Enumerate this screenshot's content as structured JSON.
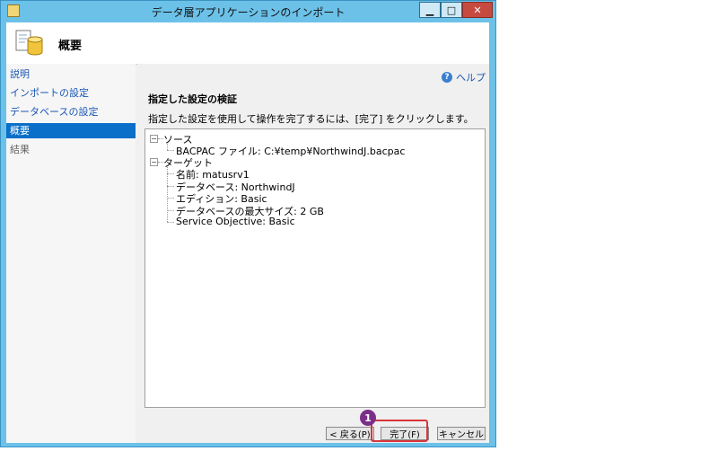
{
  "window": {
    "title": "データ層アプリケーションのインポート",
    "header_title": "概要"
  },
  "sidebar": {
    "items": [
      {
        "label": "説明",
        "state": "normal"
      },
      {
        "label": "インポートの設定",
        "state": "normal"
      },
      {
        "label": "データベースの設定",
        "state": "normal"
      },
      {
        "label": "概要",
        "state": "selected"
      },
      {
        "label": "結果",
        "state": "disabled"
      }
    ]
  },
  "main": {
    "help_label": "ヘルプ",
    "section_title": "指定した設定の検証",
    "description": "指定した設定を使用して操作を完了するには、[完了] をクリックします。",
    "tree": {
      "source": {
        "label": "ソース",
        "children": [
          "BACPAC ファイル: C:¥temp¥NorthwindJ.bacpac"
        ]
      },
      "target": {
        "label": "ターゲット",
        "children": [
          "名前: matusrv1",
          "データベース: NorthwindJ",
          "エディション: Basic",
          "データベースの最大サイズ: 2 GB",
          "Service Objective: Basic"
        ]
      }
    }
  },
  "buttons": {
    "back": "< 戻る(P)",
    "finish": "完了(F)",
    "cancel": "キャンセル"
  },
  "annotation": {
    "badge": "1",
    "color": "#7b2f89",
    "highlight_color": "#d9353a"
  },
  "colors": {
    "selected_bg": "#0a6fc8",
    "link": "#1a56b6",
    "window_frame": "#6cc1e8"
  }
}
